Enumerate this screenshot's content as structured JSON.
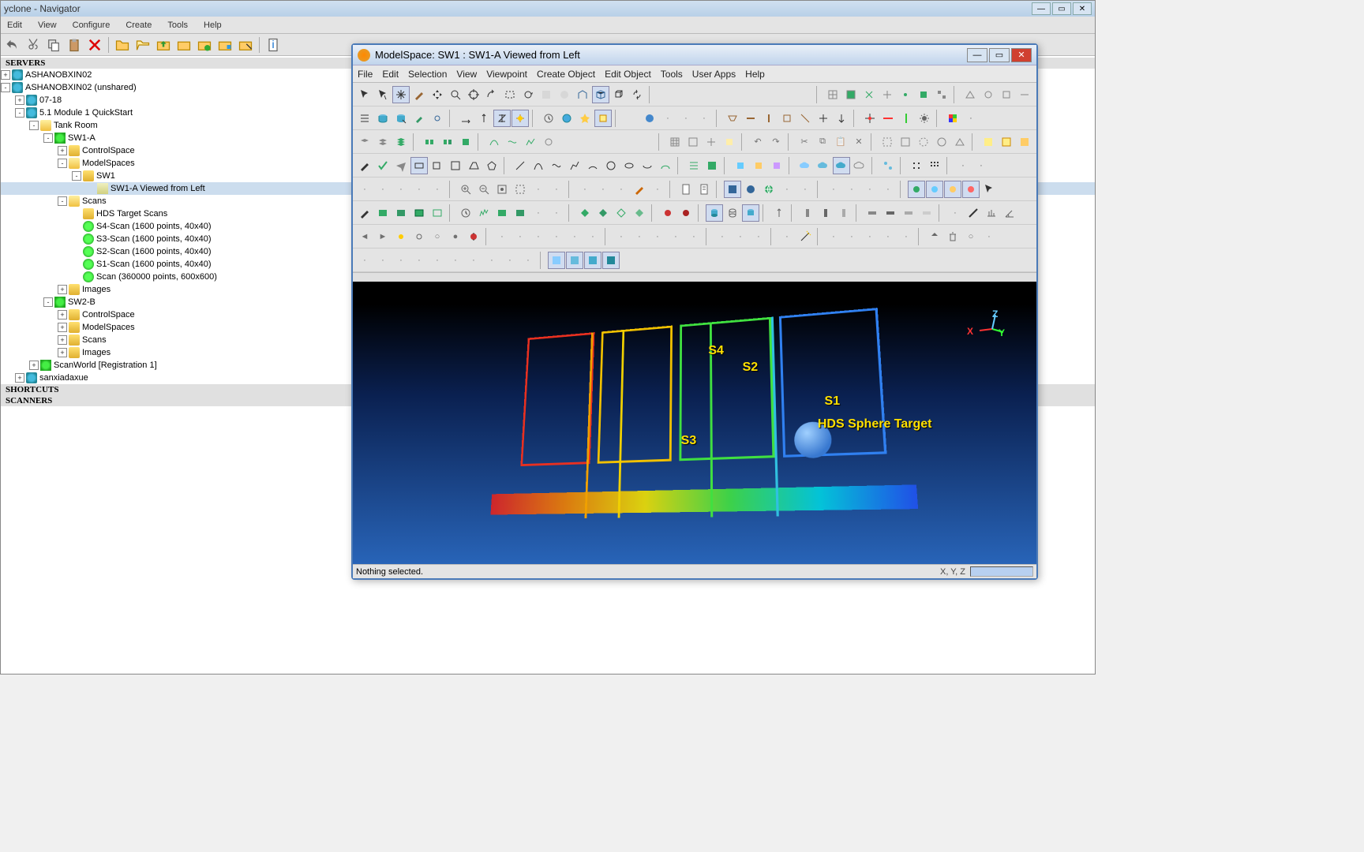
{
  "main": {
    "title": "yclone - Navigator",
    "menus": [
      "Edit",
      "View",
      "Configure",
      "Create",
      "Tools",
      "Help"
    ]
  },
  "tree": {
    "headers": {
      "servers": "SERVERS",
      "shortcuts": "SHORTCUTS",
      "scanners": "SCANNERS"
    },
    "db1": "ASHANOBXIN02",
    "db2": "ASHANOBXIN02 (unshared)",
    "n07": "07-18",
    "mod": "5.1 Module 1 QuickStart",
    "tank": "Tank Room",
    "sw1a": "SW1-A",
    "ctrl": "ControlSpace",
    "models": "ModelSpaces",
    "sw1": "SW1",
    "view_sel": "SW1-A Viewed from Left",
    "scans": "Scans",
    "hds": "HDS Target Scans",
    "s4": "S4-Scan (1600 points, 40x40)",
    "s3": "S3-Scan (1600 points, 40x40)",
    "s2": "S2-Scan (1600 points, 40x40)",
    "s1": "S1-Scan (1600 points, 40x40)",
    "bigscan": "Scan (360000 points, 600x600)",
    "images": "Images",
    "sw2b": "SW2-B",
    "ctrl2": "ControlSpace",
    "models2": "ModelSpaces",
    "scans2": "Scans",
    "images2": "Images",
    "reg": "ScanWorld [Registration 1]",
    "sanx": "sanxiadaxue"
  },
  "child": {
    "title": "ModelSpace: SW1 : SW1-A Viewed from Left",
    "menus": [
      "File",
      "Edit",
      "Selection",
      "View",
      "Viewpoint",
      "Create Object",
      "Edit Object",
      "Tools",
      "User Apps",
      "Help"
    ],
    "status_left": "Nothing selected.",
    "status_xyz": "X, Y, Z",
    "labels": {
      "s1": "S1",
      "s2": "S2",
      "s3": "S3",
      "s4": "S4",
      "hds": "HDS Sphere Target"
    },
    "axes": {
      "x": "X",
      "y": "Y",
      "z": "Z"
    }
  }
}
